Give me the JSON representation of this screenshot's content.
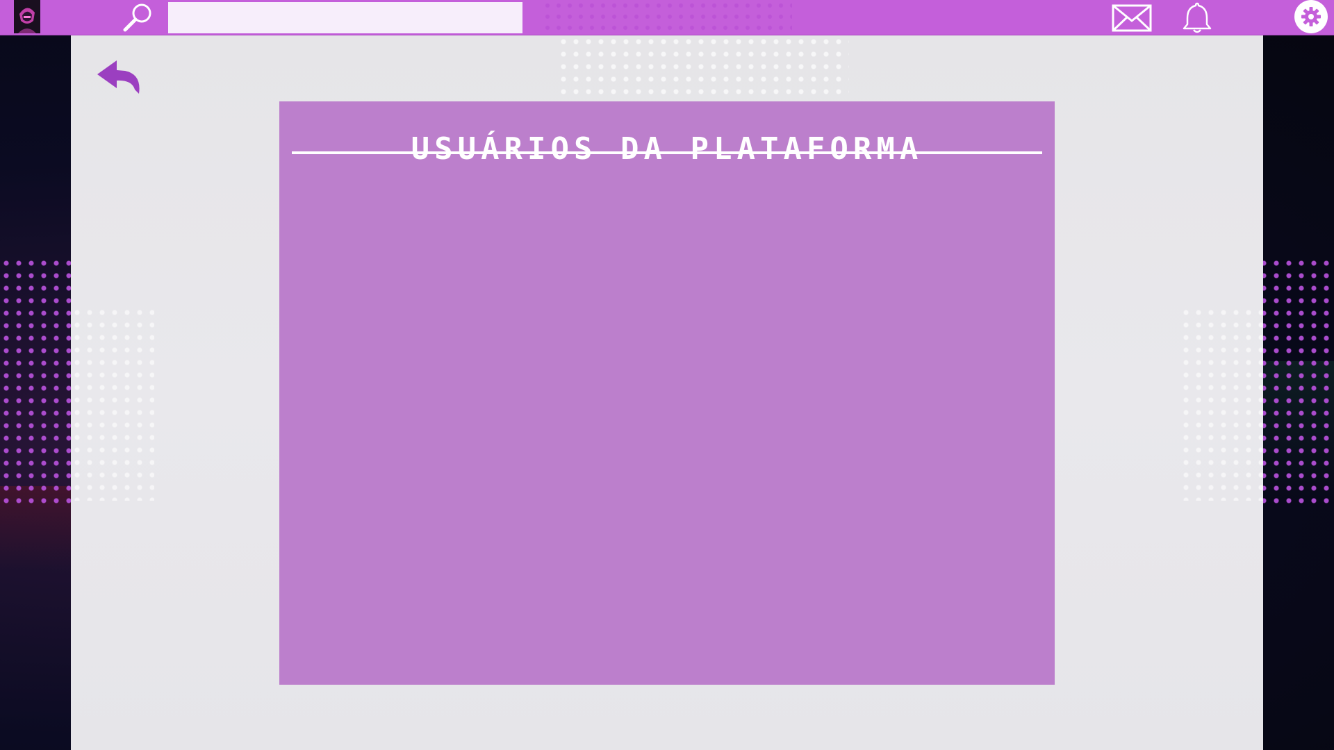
{
  "topbar": {
    "search": {
      "value": "",
      "placeholder": ""
    },
    "icons": {
      "logo": "avatar-logo",
      "search": "search-icon",
      "mail": "mail-icon",
      "notifications": "bell-icon",
      "settings": "gear-icon"
    },
    "colors": {
      "bar": "#c45fda",
      "search_bg": "#f7eefb"
    }
  },
  "main": {
    "back_icon": "back-arrow-icon",
    "users_card": {
      "title": "USUÁRIOS DA PLATAFORMA",
      "users": [],
      "color": "#bc7fcc"
    }
  }
}
